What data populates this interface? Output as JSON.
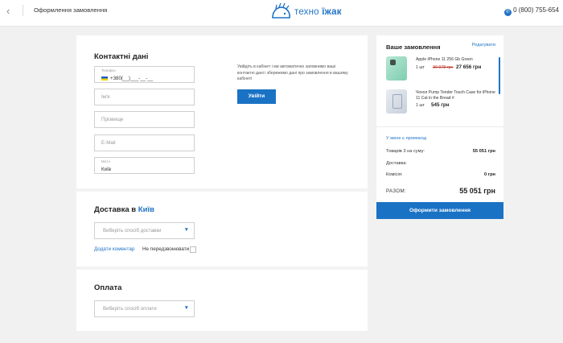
{
  "header": {
    "back_icon": "arrow-left-icon",
    "title": "Оформлення замовлення",
    "logo_text_a": "техно",
    "logo_text_b": "їжак",
    "phone": "0 (800) 755-654"
  },
  "contact": {
    "title": "Контактні дані",
    "phone_mini_label": "Телефон",
    "phone_value": "+380(__)___-__-__",
    "name_placeholder": "Ім'я",
    "surname_placeholder": "Прізвище",
    "email_placeholder": "E-Mail",
    "city_mini_label": "Місто",
    "city_value": "Київ",
    "hint": "Увійдіть в кабінет і ми автоматично заповнимо ваші контактні дані і збережемо дані про замовлення в вашому кабінеті",
    "login_label": "Увійти"
  },
  "delivery": {
    "title": "Доставка в",
    "city": "Київ",
    "select_placeholder": "Виберіть спосіб доставки",
    "add_comment": "Додати коментар",
    "dont_call": "Не передзвонювати"
  },
  "payment": {
    "title": "Оплата",
    "select_placeholder": "Виберіть спосіб оплати"
  },
  "order": {
    "title": "Ваше замовлення",
    "edit": "Редагувати",
    "items": [
      {
        "name": "Apple iPhone 11 256 Gb Green",
        "qty": "1 шт",
        "old_price": "30 978 грн",
        "price": "27 656 грн"
      },
      {
        "name": "Чохол Pump Tender Touch Case for iPhone 11 Cat in the Bread #",
        "qty": "1 шт",
        "price": "545 грн"
      }
    ],
    "promo": "У мене є промокод",
    "goods_label": "Товарів 3 на суму:",
    "goods_value": "55 051 грн",
    "delivery_label": "Доставка:",
    "commission_label": "Комісія:",
    "commission_value": "0 грн",
    "total_label": "РАЗОМ:",
    "total_value": "55 051 грн",
    "checkout": "Оформити замовлення"
  },
  "colors": {
    "accent": "#1a72c5",
    "old_price": "#c0392b",
    "background": "#f1f1f1"
  }
}
